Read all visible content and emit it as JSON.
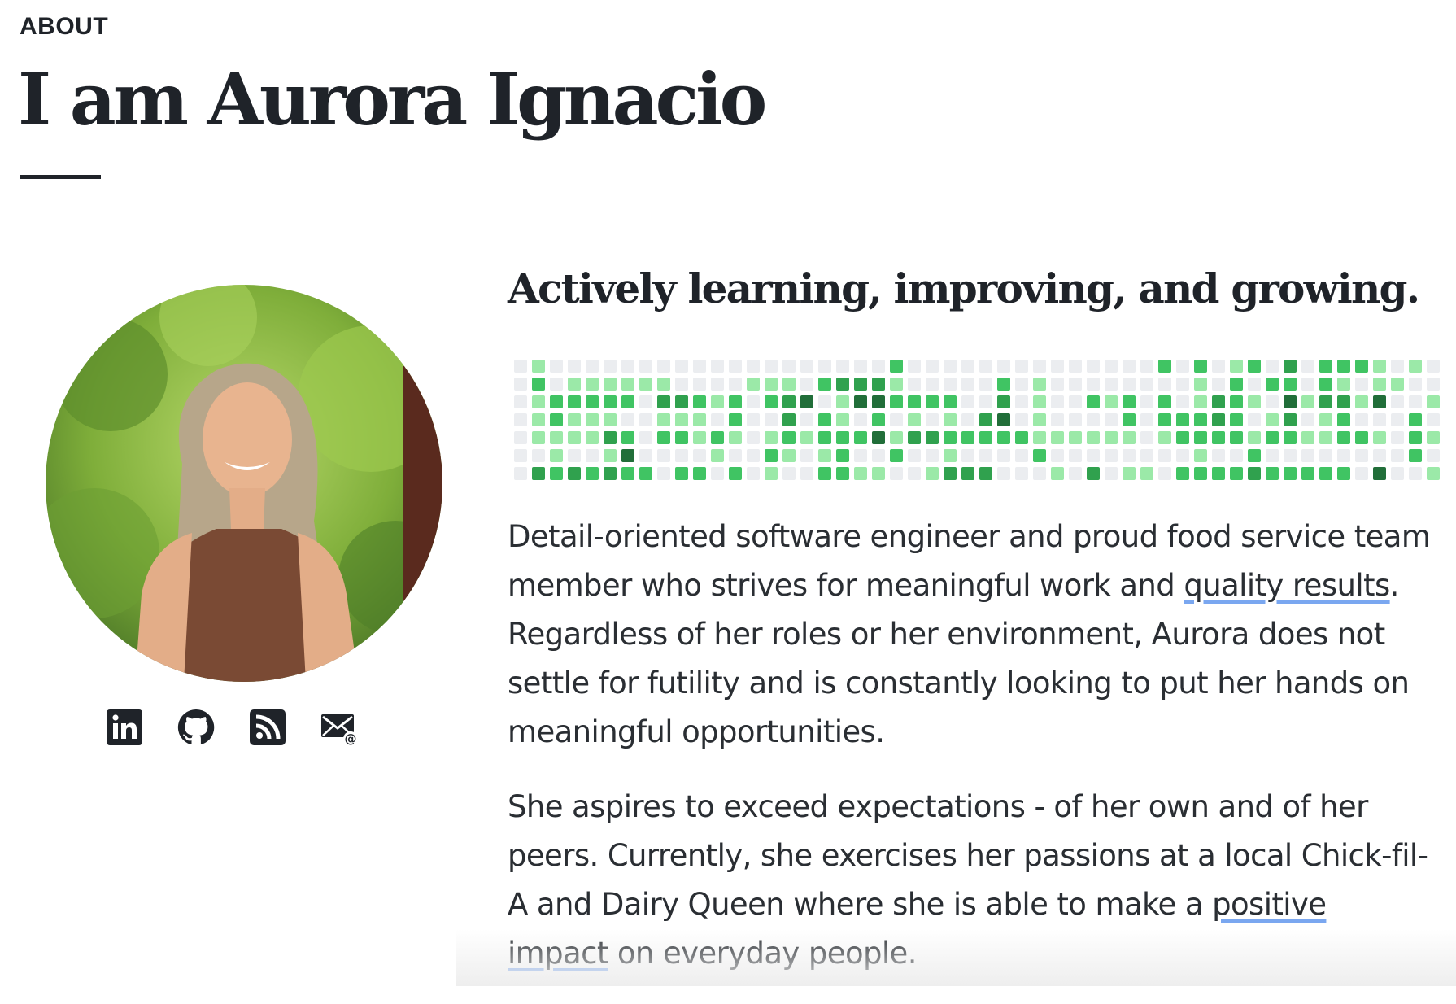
{
  "section_label": "ABOUT",
  "title": "I am Aurora Ignacio",
  "tagline": "Actively learning, improving, and growing.",
  "social_links": [
    {
      "name": "linkedin-icon"
    },
    {
      "name": "github-icon"
    },
    {
      "name": "rss-icon"
    },
    {
      "name": "email-icon"
    }
  ],
  "contribution_graph": {
    "weeks": 53,
    "levels": [
      "0100000000000000000002000000000000002020120302221010000",
      "0201111110000111023331000002010000000010202202101100010",
      "0122222033212023401442222003010021202013210413314001002",
      "0121110011102003021020101034010000202223201301200020001",
      "0111132022121012122241332222211111101222212211221021100",
      "0010014000010021012002001000020000000010020000000020000",
      "0323232202202010022110013330001030110222232222204001110"
    ],
    "colors": [
      "#ebedf0",
      "#9be9a8",
      "#40c463",
      "#30a14e",
      "#216e39"
    ]
  },
  "bio": {
    "p1": {
      "before": "Detail-oriented software engineer and proud food service team member who strives for meaningful work and ",
      "highlight": "quality results",
      "after": ". Regardless of her roles or her environment, Aurora does not settle for futility and is constantly looking to put her hands on meaningful opportunities."
    },
    "p2": {
      "before": "She aspires to exceed expectations - of her own and of her peers. Currently, she exercises her passions at a local Chick-fil-A and Dairy Queen where she is able to make a ",
      "highlight": "positive impact",
      "after": " on everyday people."
    }
  },
  "colors": {
    "text": "#1f2329",
    "highlight_underline": "#7aa7f0",
    "icon": "#1f2329"
  }
}
